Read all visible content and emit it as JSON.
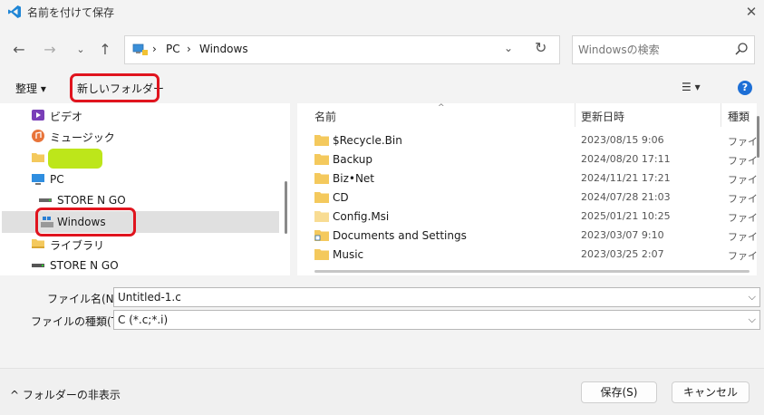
{
  "window": {
    "title": "名前を付けて保存",
    "close_glyph": "✕"
  },
  "nav": {
    "back": "←",
    "forward": "→",
    "recent": "⌄",
    "up": "↑"
  },
  "address": {
    "crumbs": [
      "PC",
      "Windows"
    ],
    "separator": "›",
    "dropdown": "⌄",
    "refresh": "↻"
  },
  "search": {
    "placeholder": "Windowsの検索"
  },
  "toolbar": {
    "organize": "整理 ▾",
    "new_folder": "新しいフォルダー",
    "view": "☰  ▾",
    "help": "?"
  },
  "sidebar": {
    "items": [
      {
        "label": "ビデオ",
        "icon": "video-icon"
      },
      {
        "label": "ミュージック",
        "icon": "music-icon"
      },
      {
        "label": "",
        "icon": "folder-icon"
      },
      {
        "label": "PC",
        "icon": "pc-icon"
      },
      {
        "label": "STORE N GO",
        "icon": "drive-icon"
      },
      {
        "label": "Windows",
        "icon": "windows-drive-icon"
      },
      {
        "label": "ライブラリ",
        "icon": "library-icon"
      },
      {
        "label": "STORE N GO",
        "icon": "drive-icon"
      }
    ]
  },
  "file_list": {
    "columns": [
      "名前",
      "更新日時",
      "種類"
    ],
    "sort_indicator": "^",
    "rows": [
      {
        "name": "$Recycle.Bin",
        "date": "2023/08/15 9:06",
        "type": "ファイ"
      },
      {
        "name": "Backup",
        "date": "2024/08/20 17:11",
        "type": "ファイ"
      },
      {
        "name": "Biz•Net",
        "date": "2024/11/21 17:21",
        "type": "ファイ"
      },
      {
        "name": "CD",
        "date": "2024/07/28 21:03",
        "type": "ファイ"
      },
      {
        "name": "Config.Msi",
        "date": "2025/01/21 10:25",
        "type": "ファイ"
      },
      {
        "name": "Documents and Settings",
        "date": "2023/03/07 9:10",
        "type": "ファイ"
      },
      {
        "name": "Music",
        "date": "2023/03/25 2:07",
        "type": "ファイ"
      }
    ]
  },
  "form": {
    "filename_label": "ファイル名(N):",
    "filename_value": "Untitled-1.c",
    "filetype_label": "ファイルの種類(T):",
    "filetype_value": "C (*.c;*.i)",
    "dropdown_glyph": "⌵"
  },
  "footer": {
    "hide_folders": "^  フォルダーの非表示",
    "save": "保存(S)",
    "cancel": "キャンセル"
  },
  "colors": {
    "highlight_red": "#e0141e",
    "accent_blue": "#1d6fd6",
    "folder_yellow": "#f4c95d"
  }
}
